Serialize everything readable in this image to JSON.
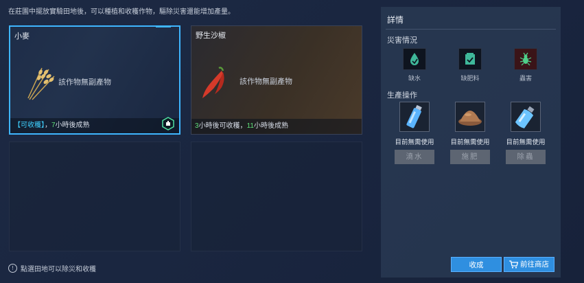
{
  "top_hint": "在莊園中擺放實驗田地後，可以種植和收穫作物，驅除災害還能增加產量。",
  "bottom_hint": "點選田地可以除災和收穫",
  "plots": [
    {
      "name": "小麥",
      "note": "該作物無副產物",
      "footer_tag": "【可收穫】",
      "footer_sep": "，",
      "footer_hours": "7",
      "footer_suffix": "小時後成熟"
    },
    {
      "name": "野生沙椒",
      "note": "該作物無副產物",
      "footer_hours1": "3",
      "footer_mid": "小時後可收穫，",
      "footer_hours2": "11",
      "footer_suffix": "小時後成熟"
    }
  ],
  "panel": {
    "title": "詳情",
    "disaster_title": "災害情況",
    "disasters": [
      {
        "label": "缺水",
        "icon": "water-drop-icon"
      },
      {
        "label": "缺肥料",
        "icon": "fertilizer-bag-icon"
      },
      {
        "label": "蟲害",
        "icon": "bug-icon"
      }
    ],
    "ops_title": "生產操作",
    "ops": [
      {
        "status": "目前無需使用",
        "button": "澆水",
        "icon": "water-bottle-icon"
      },
      {
        "status": "目前無需使用",
        "button": "施肥",
        "icon": "fertilizer-pile-icon"
      },
      {
        "status": "目前無需使用",
        "button": "除蟲",
        "icon": "spray-bottle-icon"
      }
    ],
    "harvest_button": "收成",
    "shop_button": "前往商店"
  }
}
